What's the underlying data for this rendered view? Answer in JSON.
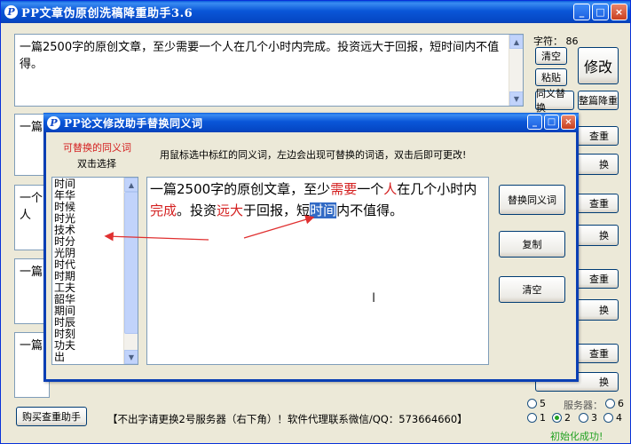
{
  "window": {
    "title": "PP文章伪原创洗稿降重助手3.6",
    "min": "_",
    "max": "□",
    "close": "×"
  },
  "main": {
    "text1": "一篇2500字的原创文章，至少需要一个人在几个小时内完成。投资远大于回报，短时间内不值得。",
    "peek2": "一篇",
    "peek3": "一个人",
    "peek4": "一篇",
    "peek5": "一篇",
    "char_label": "字符：",
    "char_count": "86",
    "btn_clear": "清空",
    "btn_paste": "粘贴",
    "btn_modify": "修改",
    "btn_synonym": "同义替换",
    "btn_whole": "整篇降重",
    "check_label": "查重",
    "replace_label": "换",
    "buy_btn": "购买查重助手",
    "notice": "【不出字请更换2号服务器（右下角）！软件代理联系微信/QQ：573664660】",
    "server_label": "服务器：",
    "radios": [
      "5",
      "6",
      "1",
      "2",
      "3",
      "4"
    ],
    "status": "初始化成功!"
  },
  "dialog": {
    "title": "PP论文修改助手替换同义词",
    "replaceable_label": "可替换的同义词",
    "dblclick_label": "双击选择",
    "instruction": "用鼠标选中标红的同义词，左边会出现可替换的词语，双击后即可更改!",
    "synonyms": [
      "时间",
      "年华",
      "时候",
      "时光",
      "技术",
      "时分",
      "光阴",
      "时代",
      "时期",
      "工夫",
      "韶华",
      "期间",
      "时辰",
      "时刻",
      "功夫",
      "出"
    ],
    "editor": {
      "seg1": "一篇2500字的原创文章，至少",
      "red1": "需要",
      "seg2": "一个",
      "red2": "人",
      "seg3": "在几个小时内",
      "red3": "完成",
      "seg4": "。投资",
      "red4": "远大",
      "seg5": "于回报，短",
      "hl": "时间",
      "seg6": "内不值得。"
    },
    "btn_replace": "替换同义词",
    "btn_copy": "复制",
    "btn_clear": "清空"
  },
  "colors": {
    "accent_red": "#d42020",
    "status_green": "#21a121",
    "arrow_red": "#e03030",
    "titlebar_blue": "#0a56d8"
  }
}
